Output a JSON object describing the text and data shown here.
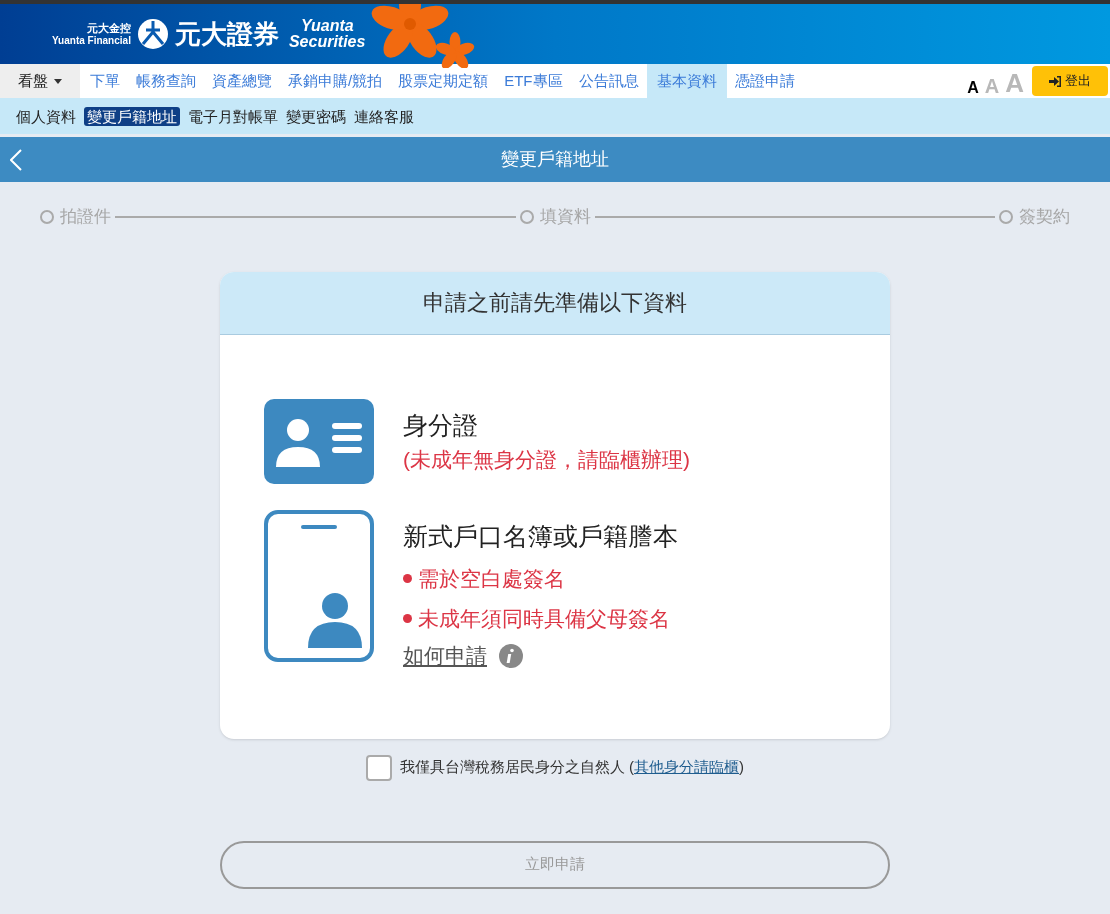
{
  "brand": {
    "group_cn": "元大金控",
    "group_en": "Yuanta Financial",
    "name_cn": "元大證券",
    "name_en_1": "Yuanta",
    "name_en_2": "Securities"
  },
  "nav": {
    "items": [
      {
        "label": "看盤",
        "kind": "dropdown",
        "selected": false
      },
      {
        "label": "下單",
        "kind": "link",
        "selected": false
      },
      {
        "label": "帳務查詢",
        "kind": "link",
        "selected": false
      },
      {
        "label": "資產總覽",
        "kind": "link",
        "selected": false
      },
      {
        "label": "承銷申購/競拍",
        "kind": "link",
        "selected": false
      },
      {
        "label": "股票定期定額",
        "kind": "link",
        "selected": false
      },
      {
        "label": "ETF專區",
        "kind": "link",
        "selected": false
      },
      {
        "label": "公告訊息",
        "kind": "link",
        "selected": false
      },
      {
        "label": "基本資料",
        "kind": "link",
        "selected": true
      },
      {
        "label": "憑證申請",
        "kind": "link",
        "selected": false
      }
    ],
    "font_sizes": [
      {
        "label": "A",
        "selected": true
      },
      {
        "label": "A",
        "selected": false
      },
      {
        "label": "A",
        "selected": false
      }
    ],
    "logout": "登出"
  },
  "subnav": [
    {
      "label": "個人資料",
      "selected": false
    },
    {
      "label": "變更戶籍地址",
      "selected": true
    },
    {
      "label": "電子月對帳單",
      "selected": false
    },
    {
      "label": "變更密碼",
      "selected": false
    },
    {
      "label": "連絡客服",
      "selected": false
    }
  ],
  "page_title": "變更戶籍地址",
  "steps": [
    {
      "label": "拍證件"
    },
    {
      "label": "填資料"
    },
    {
      "label": "簽契約"
    }
  ],
  "card": {
    "title": "申請之前請先準備以下資料",
    "documents": [
      {
        "kind": "id-card",
        "title": "身分證",
        "note": "(未成年無身分證，請臨櫃辦理)"
      },
      {
        "kind": "household",
        "title": "新式戶口名簿或戶籍謄本",
        "bullets": [
          "需於空白處簽名",
          "未成年須同時具備父母簽名"
        ],
        "link": "如何申請"
      }
    ]
  },
  "agreement": {
    "checked": false,
    "text": "我僅具台灣稅務居民身分之自然人 (",
    "link": "其他身分請臨櫃",
    "suffix": ")"
  },
  "submit": {
    "label": "立即申請",
    "disabled": true
  }
}
